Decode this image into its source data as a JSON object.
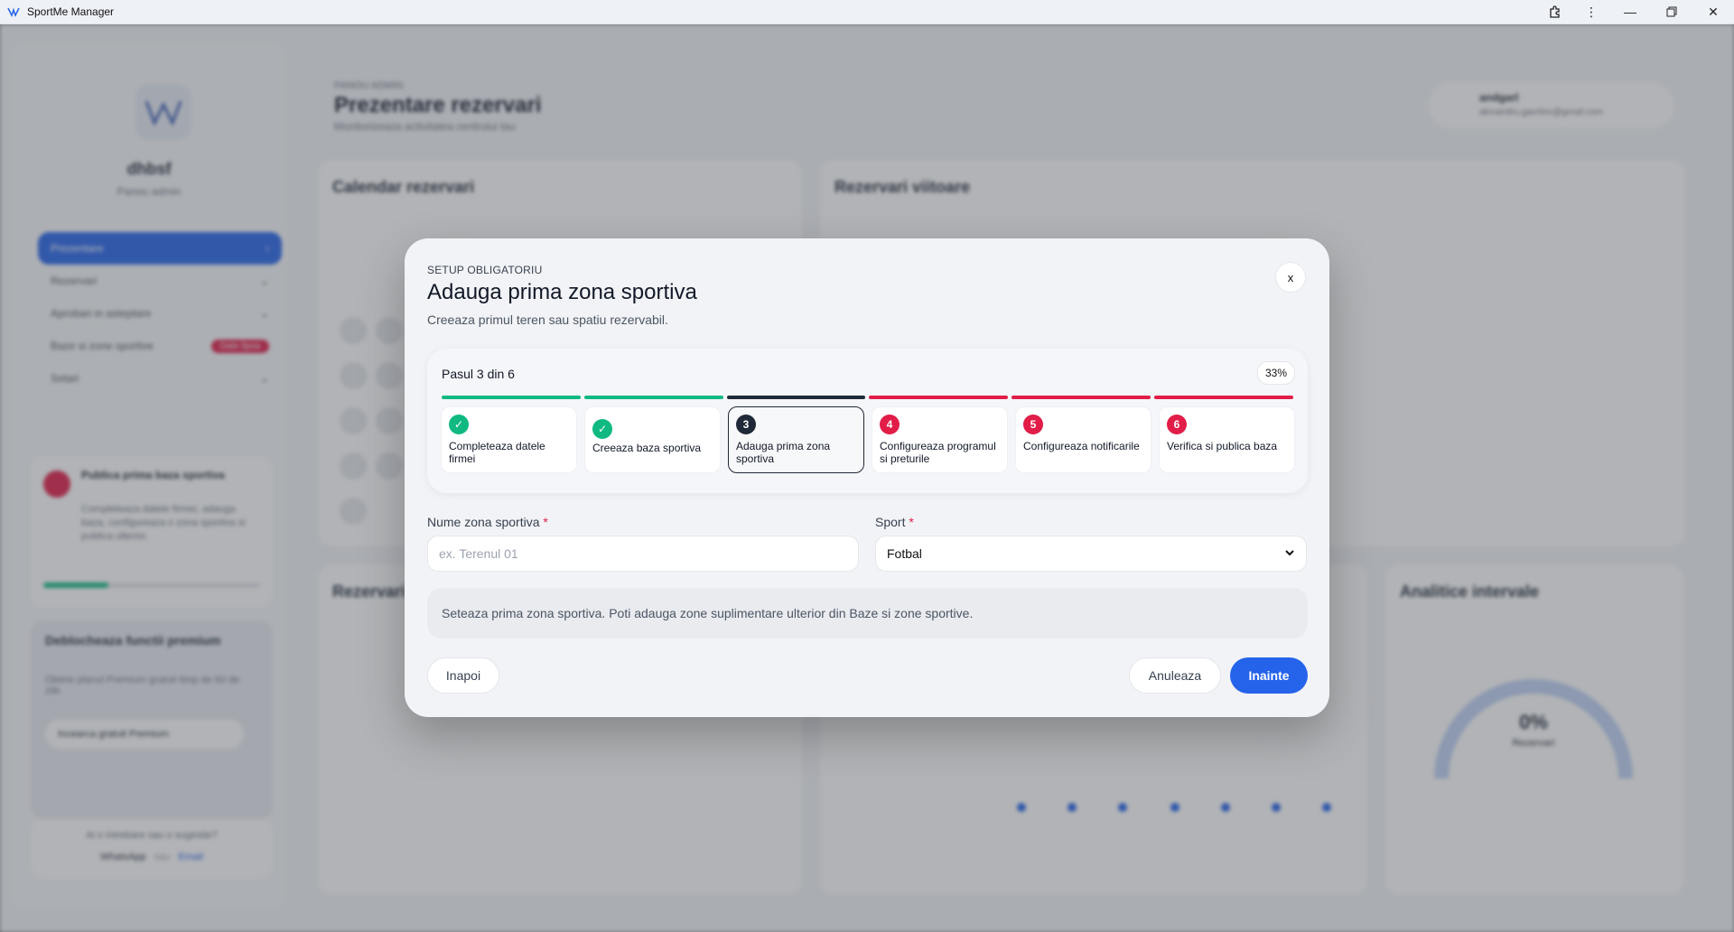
{
  "window": {
    "title": "SportMe Manager"
  },
  "background": {
    "brand_name": "dhbsf",
    "brand_sub": "Panou admin",
    "nav": [
      {
        "label": "Prezentare"
      },
      {
        "label": "Rezervari"
      },
      {
        "label": "Aprobari in asteptare"
      },
      {
        "label": "Baze si zone sportive",
        "badge": "Date lipsa"
      },
      {
        "label": "Setari"
      }
    ],
    "setup_card": {
      "title": "Publica prima baza sportiva",
      "text": "Completeaza datele firmei, adauga baza, configureaza o zona sportiva si publica ulterior."
    },
    "premium_card": {
      "title": "Deblocheaza functii premium",
      "text": "Obtine planul Premium gratuit timp de 60 de zile.",
      "button": "Incearca gratuit Premium"
    },
    "contact": {
      "question": "Ai o intrebare sau o sugestie?",
      "whatsapp": "WhatsApp",
      "or": "sau",
      "email": "Email"
    },
    "header": {
      "kicker": "PANOU ADMIN",
      "title": "Prezentare rezervari",
      "subtitle": "Monitorizeaza activitatea centrului tau",
      "user_name": "andgarl",
      "user_email": "alexandru.gavrilov@gmail.com"
    },
    "panels": {
      "calendar": "Calendar rezervari",
      "upcoming": "Rezervari viitoare",
      "reservations": "Rezervari",
      "analytics": "Analitice intervale",
      "gauge_value": "0%",
      "gauge_label": "Rezervari"
    }
  },
  "modal": {
    "kicker": "SETUP OBLIGATORIU",
    "title": "Adauga prima zona sportiva",
    "description": "Creeaza primul teren sau spatiu rezervabil.",
    "close_label": "x",
    "progress": {
      "label": "Pasul 3 din 6",
      "percent_label": "33%",
      "percent": 33
    },
    "steps": [
      {
        "marker": "✓",
        "label": "Completeaza datele firmei",
        "status": "done"
      },
      {
        "marker": "✓",
        "label": "Creeaza baza sportiva",
        "status": "done"
      },
      {
        "marker": "3",
        "label": "Adauga prima zona sportiva",
        "status": "current"
      },
      {
        "marker": "4",
        "label": "Configureaza programul si preturile",
        "status": "pending"
      },
      {
        "marker": "5",
        "label": "Configureaza notificarile",
        "status": "pending"
      },
      {
        "marker": "6",
        "label": "Verifica si publica baza",
        "status": "pending"
      }
    ],
    "fields": {
      "name_label": "Nume zona sportiva",
      "name_placeholder": "ex. Terenul 01",
      "name_value": "",
      "sport_label": "Sport",
      "sport_value": "Fotbal",
      "required_mark": "*"
    },
    "info": "Seteaza prima zona sportiva. Poti adauga zone suplimentare ulterior din Baze si zone sportive.",
    "buttons": {
      "back": "Inapoi",
      "cancel": "Anuleaza",
      "next": "Inainte"
    }
  },
  "colors": {
    "done": "#10b981",
    "current": "#1f2937",
    "pending": "#e11d48",
    "primary": "#2563eb"
  }
}
